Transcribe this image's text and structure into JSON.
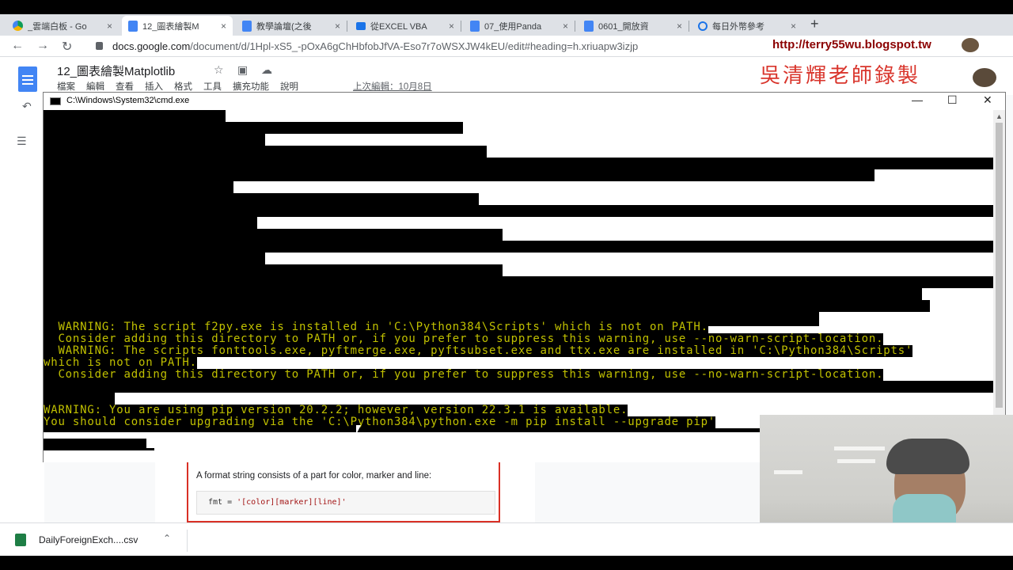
{
  "browser": {
    "tabs": [
      {
        "label": "_雲端白板 - Go",
        "icon": "drive-icon",
        "active": false
      },
      {
        "label": "12_圖表繪製M",
        "icon": "docs-icon",
        "active": true
      },
      {
        "label": "教學論壇(之後",
        "icon": "docs-icon",
        "active": false
      },
      {
        "label": "從EXCEL VBA",
        "icon": "vba-icon",
        "active": false
      },
      {
        "label": "07_使用Panda",
        "icon": "docs-icon",
        "active": false
      },
      {
        "label": "0601_開放資",
        "icon": "docs-icon",
        "active": false
      },
      {
        "label": "每日外幣參考",
        "icon": "refresh-icon",
        "active": false
      }
    ],
    "close_glyph": "×",
    "new_tab_glyph": "+",
    "url_host": "docs.google.com",
    "url_path": "/document/d/1Hpl-xS5_-pOxA6gChHbfobJfVA-Eso7r7oWSXJW4kEU/edit#heading=h.xriuapw3izjp",
    "blog_url": "http://terry55wu.blogspot.tw"
  },
  "docs": {
    "title": "12_圖表繪製Matplotlib",
    "menu": [
      "檔案",
      "編輯",
      "查看",
      "插入",
      "格式",
      "工具",
      "擴充功能",
      "說明"
    ],
    "last_edit": "上次編輯：10月8日",
    "format_desc": "A format string consists of a part for color, marker and line:",
    "format_code_var": "fmt = ",
    "format_code_str": "'[color][marker][line]'"
  },
  "watermark": {
    "teacher": "吳清輝老師錄製"
  },
  "cmd": {
    "title": "C:\\Windows\\System32\\cmd.exe",
    "lines": [
      "  WARNING: The script f2py.exe is installed in 'C:\\Python384\\Scripts' which is not on PATH.",
      "  Consider adding this directory to PATH or, if you prefer to suppress this warning, use --no-warn-script-location.",
      "  WARNING: The scripts fonttools.exe, pyftmerge.exe, pyftsubset.exe and ttx.exe are installed in 'C:\\Python384\\Scripts'",
      "which is not on PATH.",
      "  Consider adding this directory to PATH or, if you prefer to suppress this warning, use --no-warn-script-location.",
      "WARNING: You are using pip version 20.2.2; however, version 22.3.1 is available.",
      "You should consider upgrading via the 'C:\\Python384\\python.exe -m pip install --upgrade pip'"
    ]
  },
  "downloads": {
    "file_name": "DailyForeignExch....csv"
  },
  "colors": {
    "cmd_text": "#c0c000",
    "docs_blue": "#4285f4",
    "red_border": "#d93025",
    "blog_color": "#8b0000",
    "teacher_color": "#d9352c"
  }
}
